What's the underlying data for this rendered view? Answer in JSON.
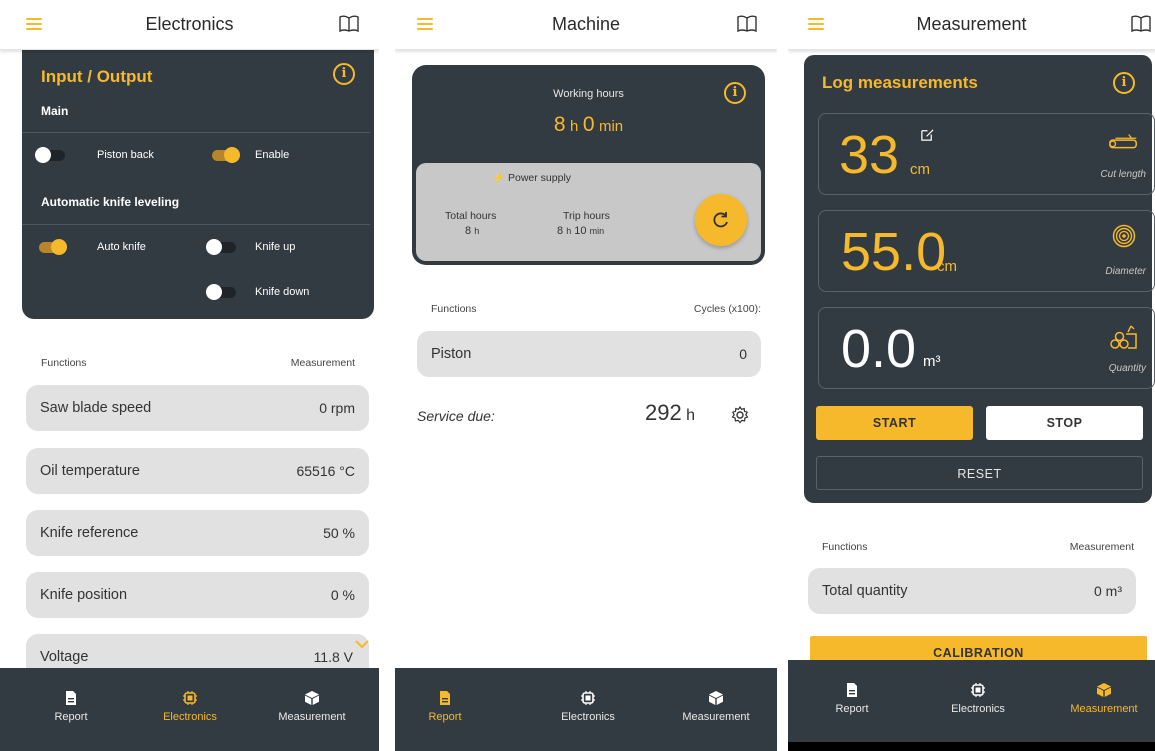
{
  "colors": {
    "accent": "#f6b92b",
    "dark": "#333b42",
    "row_bg": "#e1e1e1"
  },
  "nav": {
    "report": "Report",
    "electronics": "Electronics",
    "measurement": "Measurement"
  },
  "electronics": {
    "title": "Electronics",
    "io_card": {
      "title": "Input / Output",
      "main_label": "Main",
      "piston_back": "Piston back",
      "enable": "Enable",
      "auto_level_label": "Automatic knife leveling",
      "auto_knife": "Auto knife",
      "knife_up": "Knife up",
      "knife_down": "Knife down"
    },
    "functions_label": "Functions",
    "measurement_label": "Measurement",
    "rows": [
      {
        "label": "Saw blade speed",
        "value": "0 rpm"
      },
      {
        "label": "Oil temperature",
        "value": "65516 °C"
      },
      {
        "label": "Knife reference",
        "value": "50 %"
      },
      {
        "label": "Knife position",
        "value": "0 %"
      },
      {
        "label": "Voltage",
        "value": "11.8 V"
      }
    ]
  },
  "machine": {
    "title": "Machine",
    "working_hours_label": "Working hours",
    "working_hours_h": "8",
    "h_unit": "h",
    "working_hours_min": "0",
    "min_unit": "min",
    "power_supply": "Power supply",
    "total_hours_label": "Total hours",
    "total_hours_value": "8",
    "trip_hours_label": "Trip hours",
    "trip_hours_h": "8",
    "trip_hours_min": "10",
    "functions_label": "Functions",
    "cycles_label": "Cycles (x100):",
    "piston_label": "Piston",
    "piston_value": "0",
    "service_due_label": "Service due:",
    "service_due_value": "292",
    "service_due_unit": "h"
  },
  "measurement": {
    "title": "Measurement",
    "card_title": "Log measurements",
    "cut_length_value": "33",
    "cut_length_unit": "cm",
    "cut_length_label": "Cut length",
    "diameter_value": "55.0",
    "diameter_unit": "cm",
    "diameter_label": "Diameter",
    "quantity_value": "0.0",
    "quantity_unit": "m³",
    "quantity_label": "Quantity",
    "start": "START",
    "stop": "STOP",
    "reset": "RESET",
    "functions_label": "Functions",
    "measurement_label": "Measurement",
    "total_quantity_label": "Total quantity",
    "total_quantity_value": "0 m³",
    "calibration": "CALIBRATION"
  }
}
